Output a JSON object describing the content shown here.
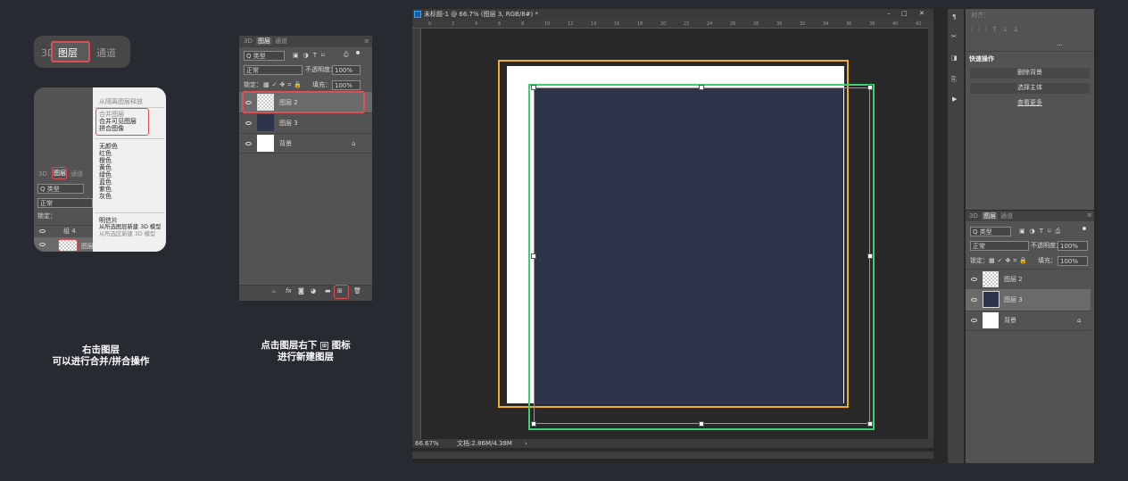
{
  "captions": {
    "left_line1": "右击图层",
    "left_line2": "可以进行合并/拼合操作",
    "mid_line1_a": "点击图层右下",
    "mid_line1_b": "图标",
    "mid_line2": "进行新建图层"
  },
  "tabs": {
    "tab_3d": "3D",
    "tab_layers": "图层",
    "tab_channels": "通道"
  },
  "layers_panel": {
    "filter_label": "Q 类型",
    "blend_mode": "正常",
    "opacity_label": "不透明度：",
    "opacity_value": "100%",
    "lock_label": "锁定：",
    "fill_label": "填充：",
    "fill_value": "100%",
    "layers": [
      {
        "name": "图层 2"
      },
      {
        "name": "图层 3"
      },
      {
        "name": "背景"
      }
    ]
  },
  "context_menu": {
    "top_item": "从隔离图层释放",
    "merge_layers": "合并图层",
    "merge_visible": "合并可见图层",
    "flatten_image": "拼合图像",
    "colors": [
      "无颜色",
      "红色",
      "橙色",
      "黄色",
      "绿色",
      "蓝色",
      "紫色",
      "灰色"
    ],
    "postcard": "明信片",
    "new_3d_from_layer": "从所选图层新建 3D 模型",
    "new_3d_from_selection": "从所选区新建 3D 模型"
  },
  "mini_panel": {
    "layer_group": "组 4",
    "layer_partial": "图层"
  },
  "document": {
    "title": "未标题-1 @ 66.7% (图层 3, RGB/8#) *",
    "zoom": "66.67%",
    "doc_info": "文档:2.86M/4.38M",
    "ruler_ticks": [
      "0",
      "2",
      "4",
      "6",
      "8",
      "10",
      "12",
      "14",
      "16",
      "18",
      "20",
      "22",
      "24",
      "26",
      "28",
      "30",
      "32",
      "34",
      "36",
      "38",
      "40",
      "42"
    ]
  },
  "right_panel": {
    "quick_actions_title": "快速操作",
    "buttons": [
      "删除背景",
      "选择主体"
    ],
    "learn_more": "查看更多",
    "align_label": "对齐："
  },
  "colors": {
    "canvas_fill": "#30344a",
    "orange_outline": "#f0ad2d",
    "green_outline": "#3ccf74",
    "highlight_red": "#e14d55"
  }
}
